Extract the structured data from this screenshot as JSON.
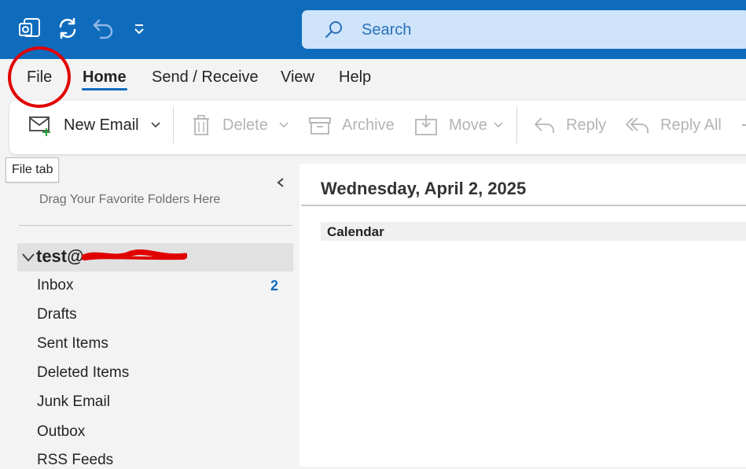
{
  "titlebar": {
    "icons": [
      "outlook-logo-icon",
      "sync-icon",
      "undo-icon",
      "customize-toolbar-icon"
    ],
    "search_placeholder": "Search"
  },
  "menu": {
    "tabs": [
      {
        "label": "File",
        "active": false
      },
      {
        "label": "Home",
        "active": true
      },
      {
        "label": "Send / Receive",
        "active": false
      },
      {
        "label": "View",
        "active": false
      },
      {
        "label": "Help",
        "active": false
      }
    ]
  },
  "ribbon": {
    "new_email": "New Email",
    "delete": "Delete",
    "archive": "Archive",
    "move": "Move",
    "reply": "Reply",
    "reply_all": "Reply All"
  },
  "tooltip": {
    "text": "File tab"
  },
  "folders": {
    "favorites_hint": "Drag Your Favorite Folders Here",
    "account_prefix": "test@",
    "items": [
      {
        "label": "Inbox",
        "count": "2"
      },
      {
        "label": "Drafts"
      },
      {
        "label": "Sent Items"
      },
      {
        "label": "Deleted Items"
      },
      {
        "label": "Junk Email"
      },
      {
        "label": "Outbox"
      },
      {
        "label": "RSS Feeds"
      }
    ]
  },
  "main": {
    "date": "Wednesday, April 2, 2025",
    "section": "Calendar"
  },
  "colors": {
    "titlebar": "#0f6cbd",
    "search_bg": "#cfe4fa",
    "accent": "#0f6cbd",
    "annotation": "#e00000"
  }
}
